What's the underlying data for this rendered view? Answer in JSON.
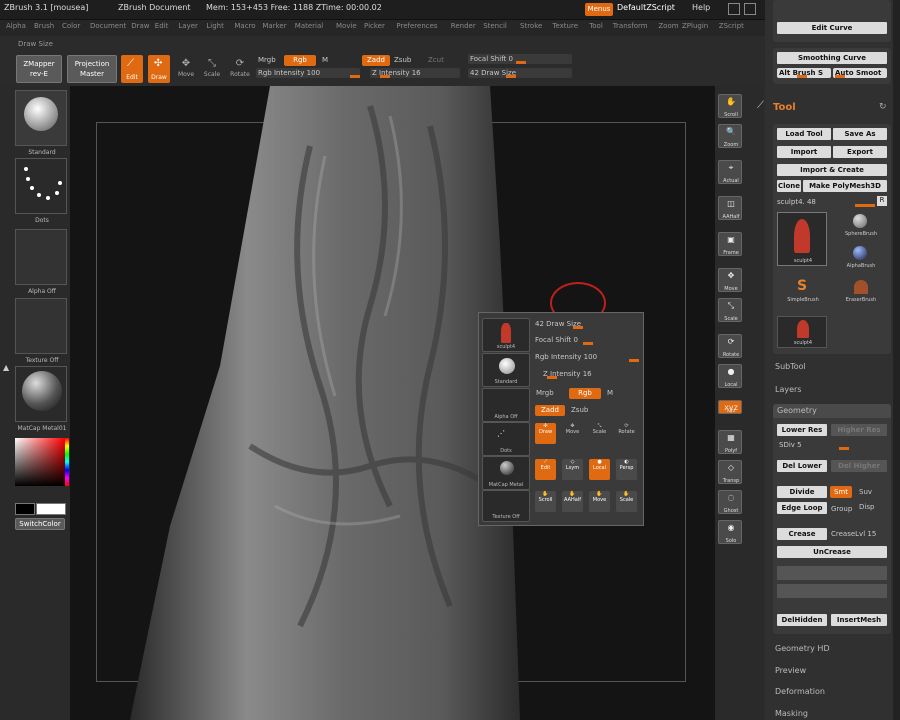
{
  "titlebar": {
    "app": "ZBrush 3.1 [mousea]",
    "doc": "ZBrush Document",
    "stats": "Mem: 153+453  Free: 1188  ZTime: 00:00.02",
    "menus_btn": "Menus",
    "script": "DefaultZScript",
    "help": "Help"
  },
  "menubar": {
    "items": [
      "Alpha",
      "Brush",
      "Color",
      "Document",
      "Draw",
      "Edit",
      "Layer",
      "Light",
      "Macro",
      "Marker",
      "Material",
      "Movie",
      "Picker",
      "Preferences",
      "Render",
      "Stencil",
      "Stroke",
      "Texture",
      "Tool",
      "Transform",
      "Zoom",
      "ZPlugin",
      "ZScript"
    ]
  },
  "draw_size_label": "Draw Size",
  "toolbar": {
    "zmapper": "ZMapper rev-E",
    "projection_master": "Projection Master",
    "edit": "Edit",
    "draw": "Draw",
    "move": "Move",
    "scale": "Scale",
    "rotate": "Rotate",
    "mrgb": "Mrgb",
    "rgb": "Rgb",
    "m": "M",
    "rgb_intensity": "Rgb Intensity 100",
    "zadd": "Zadd",
    "zsub": "Zsub",
    "zcut": "Zcut",
    "z_intensity": "Z Intensity 16",
    "focal_shift": "Focal Shift 0",
    "draw_size": "42 Draw Size"
  },
  "leftshelf": {
    "tiles": [
      "Standard",
      "Dots",
      "Alpha Off",
      "Texture Off",
      "MatCap Metal01"
    ],
    "switch_color": "SwitchColor"
  },
  "rightshelf": {
    "buttons": [
      "Scroll",
      "Zoom",
      "Actual",
      "AAHalf",
      "Frame",
      "Move",
      "Scale",
      "Rotate",
      "Local",
      "Xyz",
      "Polyf",
      "Transp",
      "Ghost",
      "Solo"
    ]
  },
  "popup": {
    "tiles": [
      "sculpt4",
      "Standard",
      "Alpha Off",
      "Dots",
      "MatCap Metal",
      "Texture Off"
    ],
    "draw_size": "42 Draw Size",
    "focal_shift": "Focal Shift 0",
    "rgb_intensity": "Rgb Intensity 100",
    "z_intensity": "Z Intensity 16",
    "mrgb": "Mrgb",
    "rgb": "Rgb",
    "m": "M",
    "zadd": "Zadd",
    "zsub": "Zsub",
    "modes": [
      "Draw",
      "Move",
      "Scale",
      "Rotate"
    ],
    "row2": [
      "Edit",
      "Lsym",
      "Local",
      "Persp"
    ],
    "row3": [
      "Scroll",
      "AAHalf",
      "Move",
      "Scale"
    ]
  },
  "palette": {
    "edit_curve": "Edit Curve",
    "smoothing_curve": "Smoothing Curve",
    "alt_brush": "Alt Brush S",
    "auto_smooth": "Auto Smoot",
    "tool_title": "Tool",
    "load_tool": "Load Tool",
    "save_as": "Save As",
    "import": "Import",
    "export": "Export",
    "import_create": "Import & Create",
    "clone": "Clone",
    "make_polymesh": "Make PolyMesh3D",
    "sculpt_label": "sculpt4. 48",
    "tools": [
      "sculpt4",
      "SphereBrush",
      "AlphaBrush",
      "SimpleBrush",
      "EraserBrush",
      "sculpt4"
    ],
    "subtool": "SubTool",
    "layers": "Layers",
    "geometry": "Geometry",
    "lower_res": "Lower Res",
    "higher_res": "Higher Res",
    "sdiv": "SDiv 5",
    "del_lower": "Del Lower",
    "del_higher": "Del Higher",
    "divide": "Divide",
    "smt": "Smt",
    "suv": "Suv",
    "edge_loop": "Edge Loop",
    "group": "Group",
    "dispmap": "Disp",
    "crease": "Crease",
    "crease_lvl": "CreaseLvl 15",
    "uncrease": "UnCrease",
    "del_hidden": "DelHidden",
    "insert_mesh": "InsertMesh",
    "geometry_hd": "Geometry HD",
    "preview": "Preview",
    "deformation": "Deformation",
    "masking": "Masking"
  },
  "colors": {
    "accent": "#e06a12",
    "bg": "#2b2b2b",
    "canvas": "#141414"
  }
}
